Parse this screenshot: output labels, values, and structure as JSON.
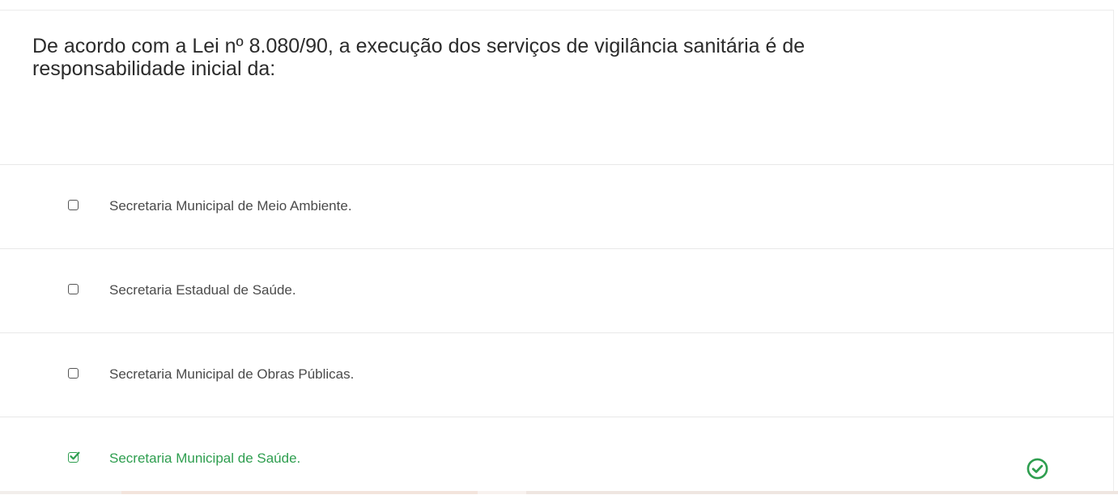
{
  "question": {
    "text": "De acordo com a Lei nº 8.080/90, a execução dos serviços de vigilância sanitária é de responsabilidade inicial da:"
  },
  "options": [
    {
      "label": "Secretaria Municipal de Meio Ambiente.",
      "checked": false,
      "status": ""
    },
    {
      "label": "Secretaria Estadual de Saúde.",
      "checked": false,
      "status": ""
    },
    {
      "label": "Secretaria Municipal de Obras Públicas.",
      "checked": false,
      "status": ""
    },
    {
      "label": "Secretaria Municipal de Saúde.",
      "checked": true,
      "status": "correct"
    }
  ],
  "icons": {
    "checkbox": "square-checkbox-icon",
    "checked": "check-square-icon",
    "result": "check-circle-icon"
  },
  "colors": {
    "correct": "#2e9e4f",
    "text": "#4a4a4a",
    "question": "#2b2b2b",
    "divider": "#e8e8e8"
  }
}
